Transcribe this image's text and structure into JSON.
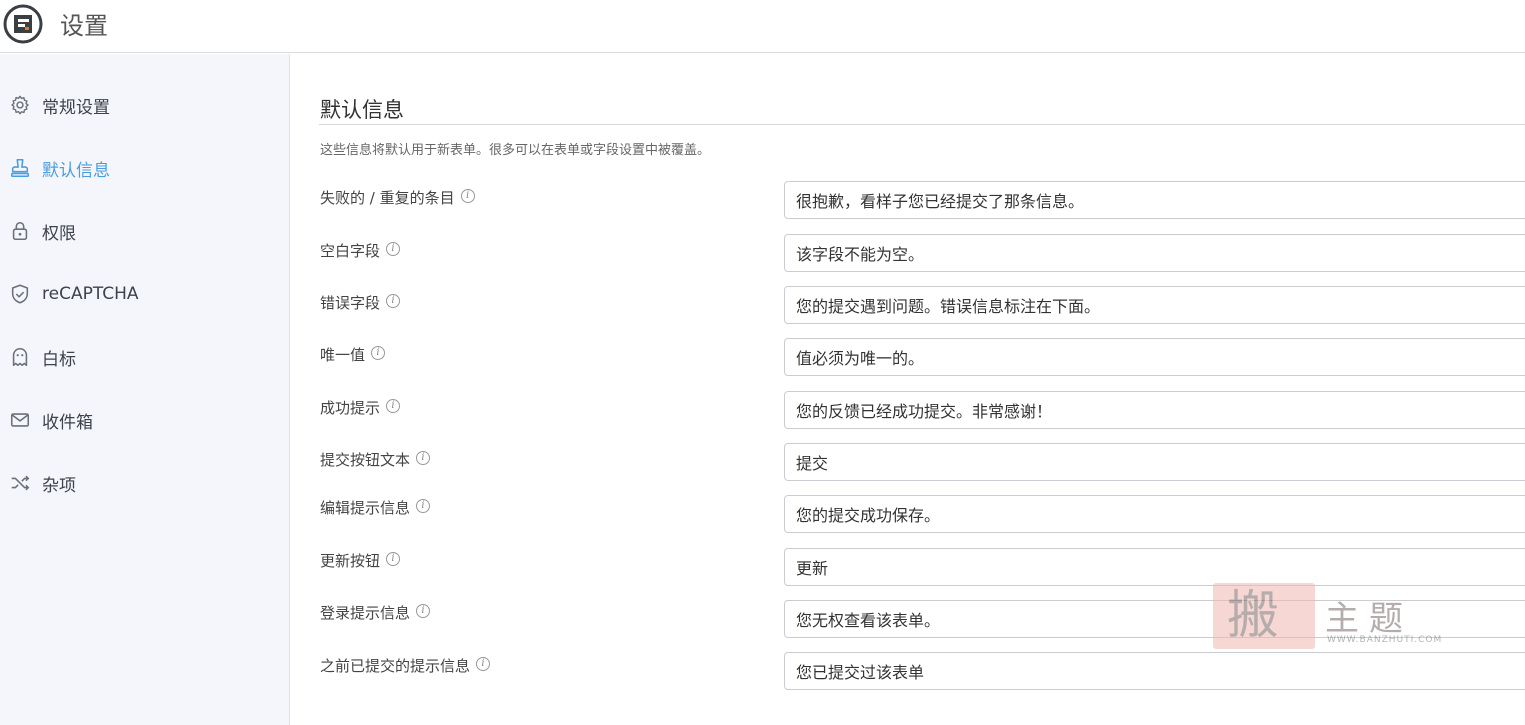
{
  "header": {
    "title": "设置",
    "logo_icon": "formidable-logo-icon"
  },
  "sidebar": {
    "active_color": "#4a9ee0",
    "items": [
      {
        "label": "常规设置",
        "icon": "gear-icon"
      },
      {
        "label": "默认信息",
        "icon": "stamp-icon"
      },
      {
        "label": "权限",
        "icon": "lock-icon"
      },
      {
        "label": "reCAPTCHA",
        "icon": "shield-check-icon"
      },
      {
        "label": "白标",
        "icon": "ghost-icon"
      },
      {
        "label": "收件箱",
        "icon": "envelope-icon"
      },
      {
        "label": "杂项",
        "icon": "shuffle-icon"
      }
    ]
  },
  "main": {
    "title": "默认信息",
    "description": "这些信息将默认用于新表单。很多可以在表单或字段设置中被覆盖。",
    "info_glyph": "i",
    "fields": [
      {
        "label": "失败的 / 重复的条目",
        "value": "很抱歉，看样子您已经提交了那条信息。"
      },
      {
        "label": "空白字段",
        "value": "该字段不能为空。"
      },
      {
        "label": "错误字段",
        "value": "您的提交遇到问题。错误信息标注在下面。"
      },
      {
        "label": "唯一值",
        "value": "值必须为唯一的。"
      },
      {
        "label": "成功提示",
        "value": "您的反馈已经成功提交。非常感谢！"
      },
      {
        "label": "提交按钮文本",
        "value": "提交"
      },
      {
        "label": "编辑提示信息",
        "value": "您的提交成功保存。"
      },
      {
        "label": "更新按钮",
        "value": "更新"
      },
      {
        "label": "登录提示信息",
        "value": "您无权查看该表单。"
      },
      {
        "label": "之前已提交的提示信息",
        "value": "您已提交过该表单"
      }
    ]
  },
  "watermark": {
    "seal": "搬",
    "text": "主题",
    "url": "WWW.BANZHUTI.COM"
  }
}
